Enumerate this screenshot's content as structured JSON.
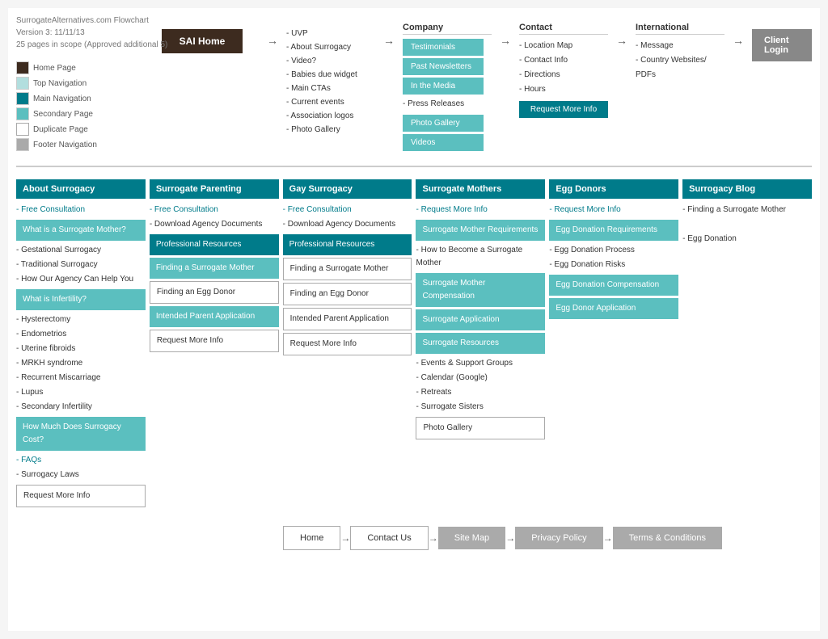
{
  "legend": {
    "title1": "SurrogateAlternatives.com Flowchart",
    "title2": "Version 3: 11/11/13",
    "title3": "25 pages in scope (Approved additional 5)",
    "items": [
      {
        "label": "Home Page",
        "type": "home"
      },
      {
        "label": "Top Navigation",
        "type": "topnav"
      },
      {
        "label": "Main Navigation",
        "type": "mainnav"
      },
      {
        "label": "Secondary Page",
        "type": "secondary"
      },
      {
        "label": "Duplicate Page",
        "type": "duplicate"
      },
      {
        "label": "Footer Navigation",
        "type": "footer"
      }
    ]
  },
  "sai_home": "SAI Home",
  "home_bullets": [
    "- UVP",
    "- About Surrogacy",
    "- Video?",
    "- Babies due widget",
    "- Main CTAs",
    "- Current events",
    "- Association logos",
    "- Photo Gallery"
  ],
  "company": {
    "title": "Company",
    "buttons": [
      "Testimonials",
      "Past Newsletters",
      "In the Media"
    ],
    "sublist": [
      "- Press Releases"
    ]
  },
  "contact": {
    "title": "Contact",
    "sublist": [
      "- Location Map",
      "- Contact Info",
      "- Directions",
      "- Hours"
    ],
    "button": "Request More Info"
  },
  "international": {
    "title": "International",
    "sublist": [
      "- Message",
      "- Country Websites/ PDFs"
    ]
  },
  "client_login": "Client Login",
  "photo_gallery_top": "Photo Gallery",
  "videos_top": "Videos",
  "columns": [
    {
      "header": "About Surrogacy",
      "items": [
        {
          "type": "teal-text",
          "text": "- Free Consultation"
        },
        {
          "type": "teal-block",
          "text": "What is a Surrogate Mother?"
        },
        {
          "type": "text",
          "text": "- Gestational Surrogacy"
        },
        {
          "type": "text",
          "text": "- Traditional Surrogacy"
        },
        {
          "type": "text",
          "text": "- How Our Agency Can Help You"
        },
        {
          "type": "teal-block",
          "text": "What is Infertility?"
        },
        {
          "type": "text",
          "text": "- Hysterectomy"
        },
        {
          "type": "text",
          "text": "- Endometrios"
        },
        {
          "type": "text",
          "text": "- Uterine fibroids"
        },
        {
          "type": "text",
          "text": "- MRKH syndrome"
        },
        {
          "type": "text",
          "text": "- Recurrent Miscarriage"
        },
        {
          "type": "text",
          "text": "- Lupus"
        },
        {
          "type": "text",
          "text": "- Secondary Infertility"
        },
        {
          "type": "teal-block",
          "text": "How Much Does Surrogacy Cost?"
        },
        {
          "type": "teal-text",
          "text": "- FAQs"
        },
        {
          "type": "text",
          "text": "- Surrogacy Laws"
        },
        {
          "type": "outline-block",
          "text": "Request More Info"
        }
      ]
    },
    {
      "header": "Surrogate Parenting",
      "items": [
        {
          "type": "teal-text",
          "text": "- Free Consultation"
        },
        {
          "type": "text",
          "text": "- Download Agency Documents"
        },
        {
          "type": "dark-teal-block",
          "text": "Professional Resources"
        },
        {
          "type": "teal-block",
          "text": "Finding a Surrogate Mother"
        },
        {
          "type": "outline-block",
          "text": "Finding an Egg Donor"
        },
        {
          "type": "teal-block",
          "text": "Intended Parent Application"
        },
        {
          "type": "outline-block",
          "text": "Request More Info"
        }
      ]
    },
    {
      "header": "Gay Surrogacy",
      "items": [
        {
          "type": "teal-text",
          "text": "- Free Consultation"
        },
        {
          "type": "text",
          "text": "- Download Agency Documents"
        },
        {
          "type": "dark-teal-block",
          "text": "Professional Resources"
        },
        {
          "type": "outline-block",
          "text": "Finding a Surrogate Mother"
        },
        {
          "type": "outline-block",
          "text": "Finding an Egg Donor"
        },
        {
          "type": "outline-block",
          "text": "Intended Parent Application"
        },
        {
          "type": "outline-block",
          "text": "Request More Info"
        }
      ]
    },
    {
      "header": "Surrogate Mothers",
      "items": [
        {
          "type": "teal-text",
          "text": "- Request More Info"
        },
        {
          "type": "teal-block",
          "text": "Surrogate Mother Requirements"
        },
        {
          "type": "text",
          "text": "- How to Become a Surrogate Mother"
        },
        {
          "type": "teal-block",
          "text": "Surrogate Mother Compensation"
        },
        {
          "type": "teal-block",
          "text": "Surrogate Application"
        },
        {
          "type": "teal-block",
          "text": "Surrogate Resources"
        },
        {
          "type": "text",
          "text": "- Events & Support Groups"
        },
        {
          "type": "text",
          "text": "- Calendar (Google)"
        },
        {
          "type": "text",
          "text": "- Retreats"
        },
        {
          "type": "text",
          "text": "- Surrogate Sisters"
        },
        {
          "type": "outline-block",
          "text": "Photo Gallery"
        }
      ]
    },
    {
      "header": "Egg Donors",
      "items": [
        {
          "type": "teal-text",
          "text": "- Request More Info"
        },
        {
          "type": "teal-block",
          "text": "Egg Donation Requirements"
        },
        {
          "type": "text",
          "text": "- Egg Donation Process"
        },
        {
          "type": "text",
          "text": "- Egg Donation Risks"
        },
        {
          "type": "teal-block",
          "text": "Egg Donation Compensation"
        },
        {
          "type": "teal-block",
          "text": "Egg Donor Application"
        }
      ]
    },
    {
      "header": "Surrogacy Blog",
      "items": [
        {
          "type": "text",
          "text": "- Finding a Surrogate Mother"
        },
        {
          "type": "text",
          "text": ""
        },
        {
          "type": "text",
          "text": "- Egg Donation"
        }
      ]
    }
  ],
  "footer": {
    "items": [
      "Home",
      "Contact Us",
      "Site Map",
      "Privacy Policy",
      "Terms & Conditions"
    ]
  }
}
